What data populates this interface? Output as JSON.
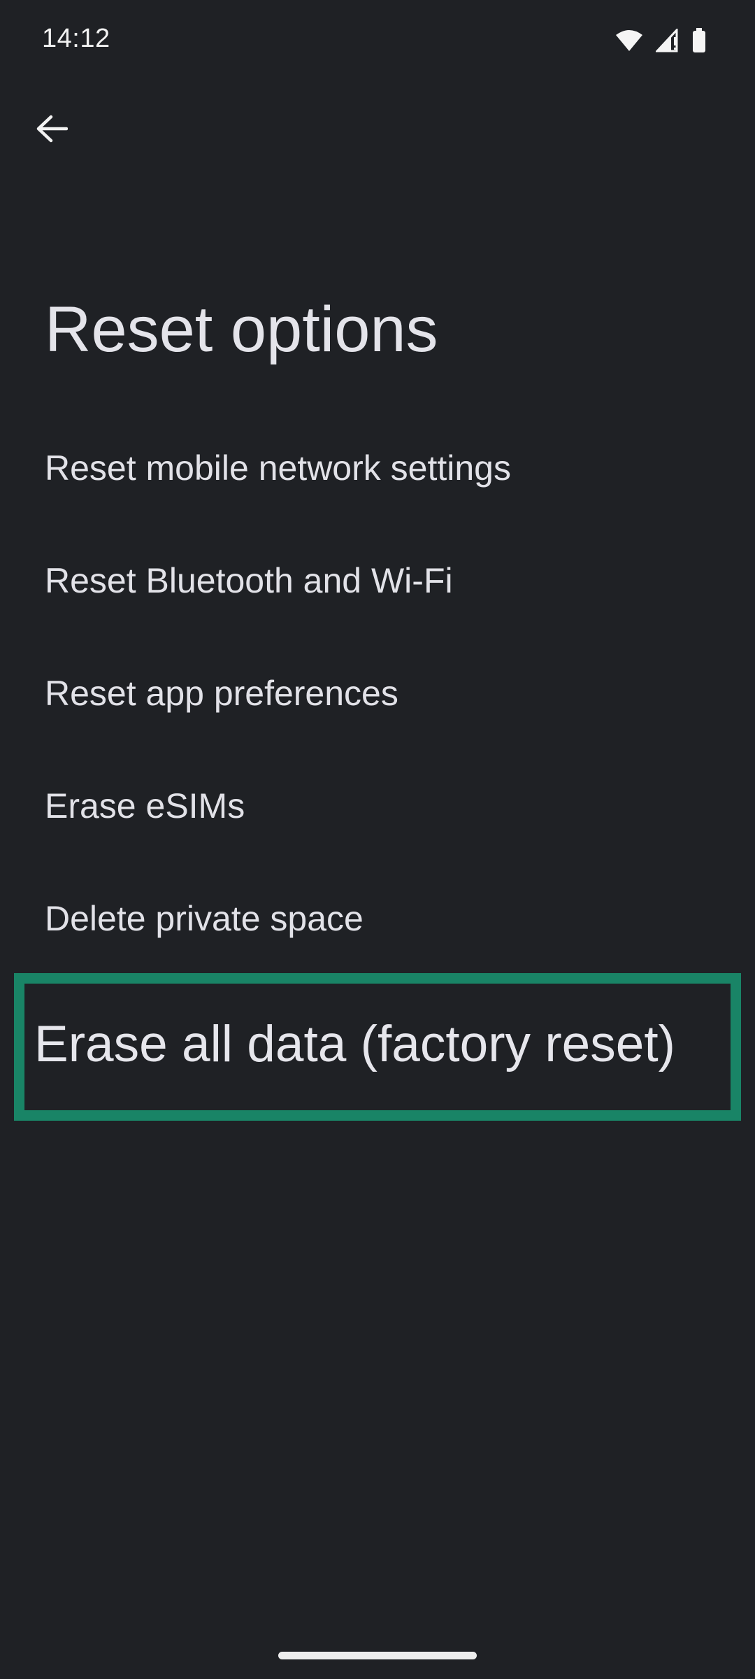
{
  "status_bar": {
    "time": "14:12",
    "icons": [
      "wifi-icon",
      "cell-signal-icon",
      "battery-icon"
    ]
  },
  "navigation": {
    "back_icon": "arrow-left-icon"
  },
  "page": {
    "title": "Reset options"
  },
  "menu": {
    "items": [
      {
        "label": "Reset mobile network settings"
      },
      {
        "label": "Reset Bluetooth and Wi-Fi"
      },
      {
        "label": "Reset app preferences"
      },
      {
        "label": "Erase eSIMs"
      },
      {
        "label": "Delete private space"
      }
    ],
    "highlighted_item": {
      "label": "Erase all data (factory reset)"
    }
  },
  "colors": {
    "background": "#1f2125",
    "text": "#e3e3e8",
    "highlight_border": "#198466"
  }
}
